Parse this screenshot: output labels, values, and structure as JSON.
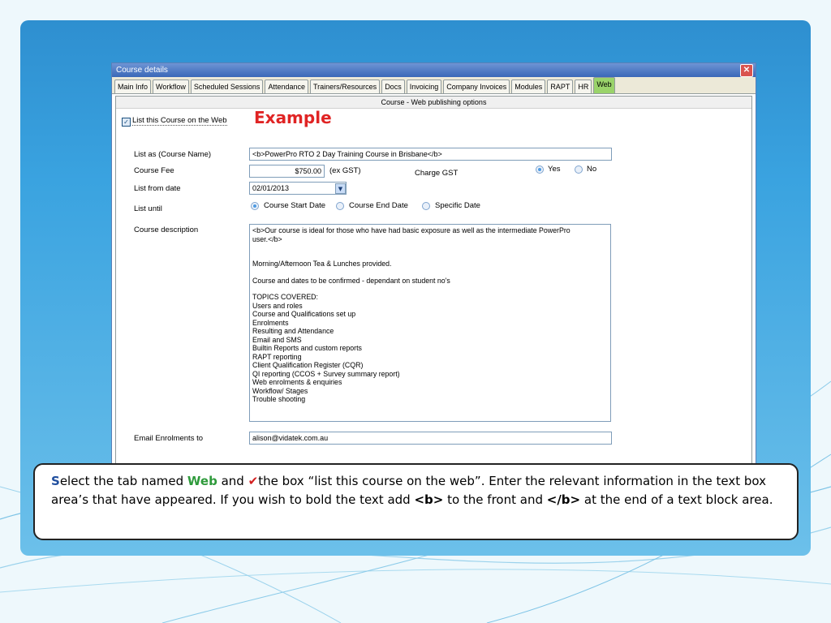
{
  "window": {
    "title": "Course details",
    "close_label": "✕",
    "tabs": [
      "Main Info",
      "Workflow",
      "Scheduled Sessions",
      "Attendance",
      "Trainers/Resources",
      "Docs",
      "Invoicing",
      "Company Invoices",
      "Modules",
      "RAPT",
      "HR",
      "Web"
    ],
    "active_tab": "Web"
  },
  "panel": {
    "header": "Course - Web publishing options",
    "list_on_web_label": "List this Course on the Web",
    "list_on_web_checked": true
  },
  "example_label": "Example",
  "form": {
    "list_as_label": "List as (Course Name)",
    "list_as_value": "<b>PowerPro RTO 2 Day Training Course in Brisbane</b>",
    "fee_label": "Course Fee",
    "fee_value": "$750.00",
    "fee_note": "(ex GST)",
    "charge_gst_label": "Charge GST",
    "yes_label": "Yes",
    "no_label": "No",
    "gst_selected": "Yes",
    "list_from_label": "List from date",
    "list_from_value": "02/01/2013",
    "list_until_label": "List until",
    "until_options": [
      "Course Start Date",
      "Course End Date",
      "Specific Date"
    ],
    "until_selected": "Course Start Date",
    "description_label": "Course description",
    "description_lines": [
      "<b>Our course is ideal for those who have had basic exposure as well as the intermediate PowerPro",
      "user.</b>",
      "",
      "",
      "Morning/Afternoon Tea & Lunches provided.",
      "",
      "Course and dates to be confirmed - dependant on student no's",
      "",
      "TOPICS COVERED:",
      "Users and roles",
      "Course and Qualifications set up",
      "Enrolments",
      "Resulting and Attendance",
      "Email and SMS",
      "Builtin Reports and custom reports",
      "RAPT reporting",
      "Client Qualification Register (CQR)",
      "QI reporting (CCOS + Survey summary report)",
      "Web enrolments & enquiries",
      "Workflow/ Stages",
      "Trouble shooting"
    ],
    "email_label": "Email Enrolments to",
    "email_value": "alison@vidatek.com.au"
  },
  "callout": {
    "first_letter": "S",
    "text_1": "elect the tab named ",
    "web_word": "Web",
    "text_2": "  and ",
    "check_mark": "✔",
    "text_3": "the box “list this course on the web”. Enter the relevant information in the text box area’s that have appeared. If you wish to bold the text add ",
    "tag_open": "<b>",
    "text_4": " to the front and ",
    "tag_close": "</b>",
    "text_5": " at the end of a text block area."
  },
  "colors": {
    "accent_blue": "#3aa3e0",
    "example_red": "#e02424",
    "web_green": "#2e9a3b",
    "active_tab_green": "#9ad36a"
  }
}
